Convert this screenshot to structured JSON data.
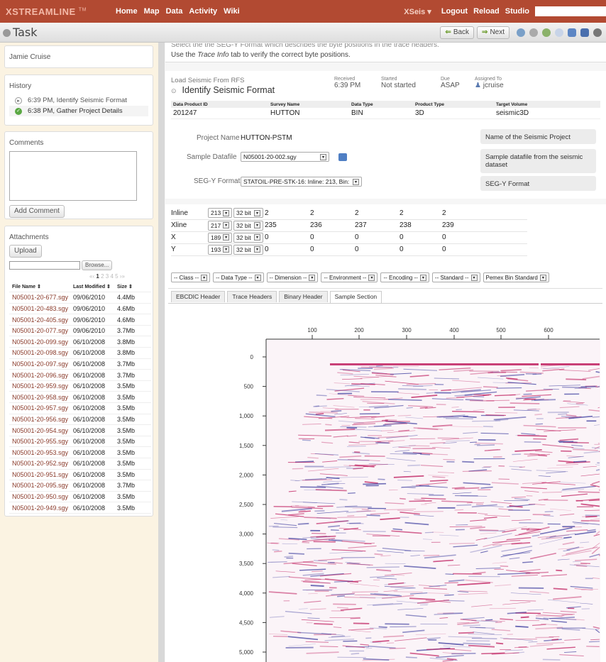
{
  "topbar": {
    "brand": "XSTREAMLINE",
    "tm": "TM",
    "nav": [
      "Home",
      "Map",
      "Data",
      "Activity",
      "Wiki"
    ],
    "right_dropdown": "XSeis",
    "right_links": [
      "Logout",
      "Reload",
      "Studio"
    ]
  },
  "taskbar": {
    "title": "Task",
    "back_label": "Back",
    "next_label": "Next"
  },
  "left": {
    "user_name": "Jamie Cruise",
    "history_title": "History",
    "history": [
      {
        "text": "6:39 PM, Identify Seismic Format",
        "status": "current"
      },
      {
        "text": "6:38 PM, Gather Project Details",
        "status": "done"
      }
    ],
    "comments_title": "Comments",
    "add_comment_label": "Add Comment",
    "attachments_title": "Attachments",
    "upload_label": "Upload",
    "browse_label": "Browse...",
    "pager": [
      "1",
      "2",
      "3",
      "4",
      "5"
    ],
    "columns": [
      "File Name ⇕",
      "Last Modified ⇕",
      "Size ⇕"
    ],
    "files": [
      [
        "N05001-20-677.sgy",
        "09/06/2010",
        "4.4Mb"
      ],
      [
        "N05001-20-483.sgy",
        "09/06/2010",
        "4.6Mb"
      ],
      [
        "N05001-20-405.sgy",
        "09/06/2010",
        "4.6Mb"
      ],
      [
        "N05001-20-077.sgy",
        "09/06/2010",
        "3.7Mb"
      ],
      [
        "N05001-20-099.sgy",
        "06/10/2008",
        "3.8Mb"
      ],
      [
        "N05001-20-098.sgy",
        "06/10/2008",
        "3.8Mb"
      ],
      [
        "N05001-20-097.sgy",
        "06/10/2008",
        "3.7Mb"
      ],
      [
        "N05001-20-096.sgy",
        "06/10/2008",
        "3.7Mb"
      ],
      [
        "N05001-20-959.sgy",
        "06/10/2008",
        "3.5Mb"
      ],
      [
        "N05001-20-958.sgy",
        "06/10/2008",
        "3.5Mb"
      ],
      [
        "N05001-20-957.sgy",
        "06/10/2008",
        "3.5Mb"
      ],
      [
        "N05001-20-956.sgy",
        "06/10/2008",
        "3.5Mb"
      ],
      [
        "N05001-20-954.sgy",
        "06/10/2008",
        "3.5Mb"
      ],
      [
        "N05001-20-955.sgy",
        "06/10/2008",
        "3.5Mb"
      ],
      [
        "N05001-20-953.sgy",
        "06/10/2008",
        "3.5Mb"
      ],
      [
        "N05001-20-952.sgy",
        "06/10/2008",
        "3.5Mb"
      ],
      [
        "N05001-20-951.sgy",
        "06/10/2008",
        "3.5Mb"
      ],
      [
        "N05001-20-095.sgy",
        "06/10/2008",
        "3.7Mb"
      ],
      [
        "N05001-20-950.sgy",
        "06/10/2008",
        "3.5Mb"
      ],
      [
        "N05001-20-949.sgy",
        "06/10/2008",
        "3.5Mb"
      ]
    ]
  },
  "instructions": {
    "line1": "Select the the SEG-Y Format which describes the byte positions in the trace headers.",
    "line2_pre": "Use the ",
    "line2_em": "Trace Info",
    "line2_post": " tab to verify the correct byte positions."
  },
  "task": {
    "subtitle": "Load Seismic From RFS",
    "title": "Identify Seismic Format",
    "received_label": "Received",
    "received": "6:39 PM",
    "started_label": "Started",
    "started": "Not started",
    "due_label": "Due",
    "due": "ASAP",
    "assigned_label": "Assigned To",
    "assigned": "jcruise",
    "columns": [
      "Data Product ID",
      "Survey Name",
      "Data Type",
      "Product Type",
      "Target Volume"
    ],
    "row": [
      "201247",
      "HUTTON",
      "BIN",
      "3D",
      "seismic3D"
    ]
  },
  "form": {
    "project_label": "Project Name",
    "project_value": "HUTTON-PSTM",
    "datafile_label": "Sample Datafile",
    "datafile_value": "N05001-20-002.sgy",
    "segy_label": "SEG-Y Format",
    "segy_value": "STATOIL-PRE-STK-16: Inline: 213, Bin: 21",
    "help_project": "Name of the Seismic Project",
    "help_datafile": "Sample datafile from the seismic dataset",
    "help_segy": "SEG-Y Format"
  },
  "bytes": [
    {
      "name": "Inline",
      "pos": "213",
      "fmt": "32 bit i",
      "vals": [
        "2",
        "2",
        "2",
        "2",
        "2"
      ]
    },
    {
      "name": "Xline",
      "pos": "217",
      "fmt": "32 bit i",
      "vals": [
        "235",
        "236",
        "237",
        "238",
        "239"
      ]
    },
    {
      "name": "X",
      "pos": "189",
      "fmt": "32 bit i",
      "vals": [
        "0",
        "0",
        "0",
        "0",
        "0"
      ]
    },
    {
      "name": "Y",
      "pos": "193",
      "fmt": "32 bit i",
      "vals": [
        "0",
        "0",
        "0",
        "0",
        "0"
      ]
    }
  ],
  "filters": [
    "-- Class --",
    "-- Data Type --",
    "-- Dimension --",
    "-- Environment --",
    "-- Encoding --",
    "-- Standard --",
    "Pemex Bin Standard"
  ],
  "tabs": [
    "EBCDIC Header",
    "Trace Headers",
    "Binary Header",
    "Sample Section"
  ],
  "section": {
    "x_ticks": [
      "100",
      "200",
      "300",
      "400",
      "500",
      "600"
    ],
    "y_ticks": [
      "0",
      "500",
      "1,000",
      "1,500",
      "2,000",
      "2,500",
      "3,000",
      "3,500",
      "4,000",
      "4,500",
      "5,000"
    ]
  },
  "colors": {
    "topbar": "#b24a32",
    "link": "#8a3a2a",
    "seismic_pos": "#c02060",
    "seismic_neg": "#4040a0"
  }
}
